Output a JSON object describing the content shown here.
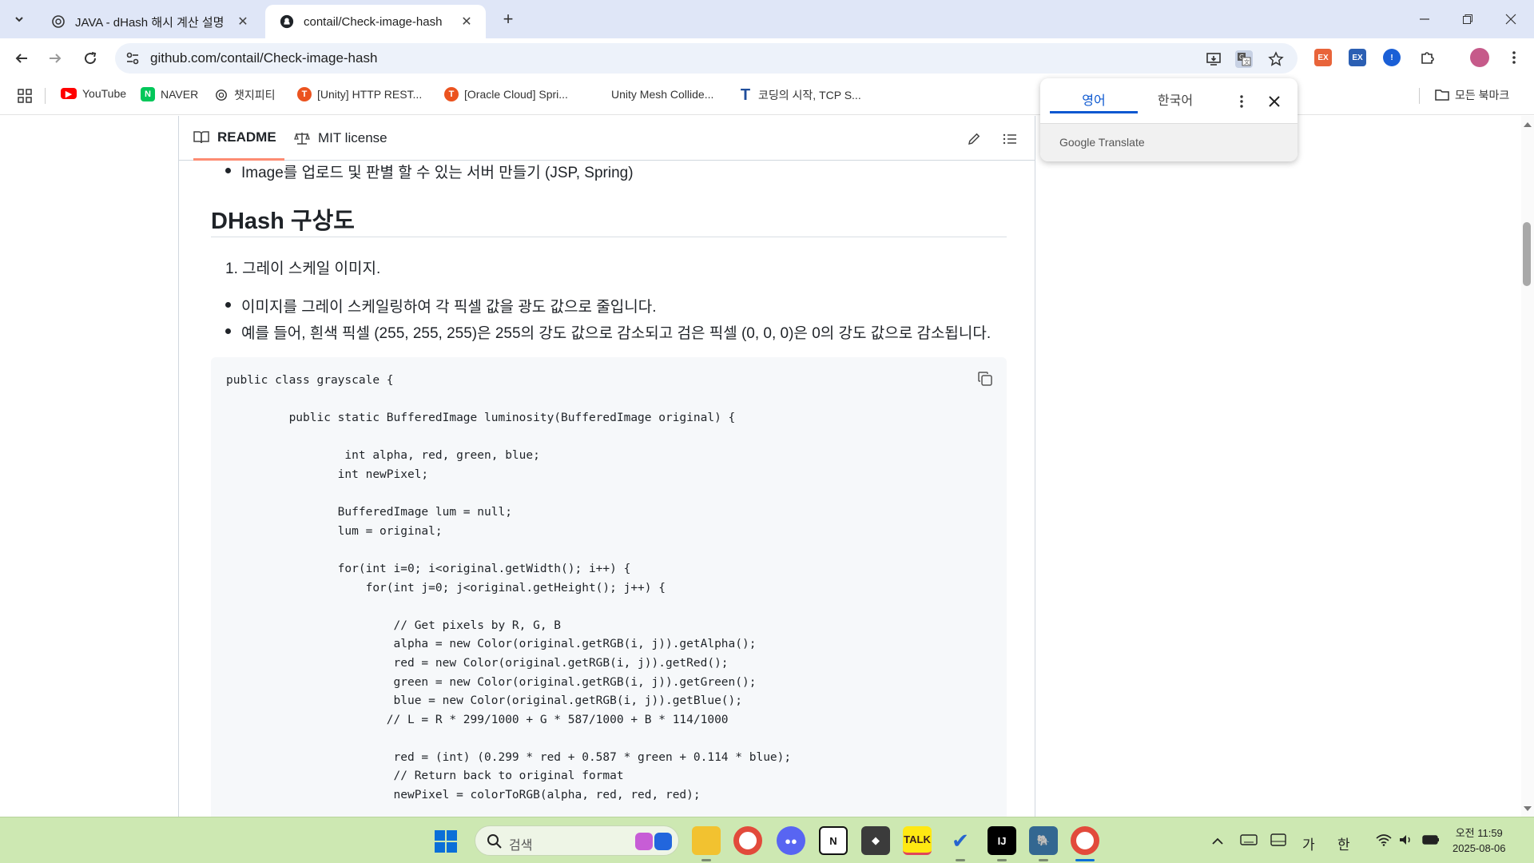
{
  "browser": {
    "tabs": [
      {
        "title": "JAVA - dHash 해시 계산 설명",
        "icon": "chatgpt-icon"
      },
      {
        "title": "contail/Check-image-hash",
        "icon": "github-icon"
      }
    ],
    "url": "github.com/contail/Check-image-hash"
  },
  "bookmarks": [
    {
      "label": "YouTube",
      "icon": "youtube-icon",
      "color": "#ff0000"
    },
    {
      "label": "NAVER",
      "icon": "naver-icon",
      "color": "#03c75a"
    },
    {
      "label": "챗지피티",
      "icon": "chatgpt-icon",
      "color": "#333333"
    },
    {
      "label": "[Unity] HTTP REST...",
      "icon": "tistory-icon",
      "color": "#eb531f"
    },
    {
      "label": "[Oracle Cloud] Spri...",
      "icon": "tistory-icon",
      "color": "#eb531f"
    },
    {
      "label": "Unity Mesh Collide...",
      "icon": "unity-icon",
      "color": "#222222"
    },
    {
      "label": "코딩의 시작, TCP S...",
      "icon": "tcp-school-icon",
      "color": "#1f4e9c"
    }
  ],
  "bookmarks_all": "모든 북마크",
  "translate": {
    "lang_from": "영어",
    "lang_to": "한국어",
    "brand": "Google Translate"
  },
  "readme": {
    "tab_readme": "README",
    "tab_license": "MIT license",
    "top_bullet": "Image를 업로드 및 판별 할 수 있는 서버 만들기 (JSP, Spring)",
    "heading": "DHash 구상도",
    "ordered_item": "1. 그레이 스케일 이미지.",
    "bullets": [
      "이미지를 그레이 스케일링하여 각 픽셀 값을 광도 값으로 줄입니다.",
      "예를 들어, 흰색 픽셀 (255, 255, 255)은 255의 강도 값으로 감소되고 검은 픽셀 (0, 0, 0)은 0의 강도 값으로 감소됩니다."
    ],
    "code": "public class grayscale {\n\n         public static BufferedImage luminosity(BufferedImage original) {\n\n                 int alpha, red, green, blue;\n                int newPixel;\n\n                BufferedImage lum = null;\n                lum = original;\n\n                for(int i=0; i<original.getWidth(); i++) {\n                    for(int j=0; j<original.getHeight(); j++) {\n\n                        // Get pixels by R, G, B\n                        alpha = new Color(original.getRGB(i, j)).getAlpha();\n                        red = new Color(original.getRGB(i, j)).getRed();\n                        green = new Color(original.getRGB(i, j)).getGreen();\n                        blue = new Color(original.getRGB(i, j)).getBlue();\n                       // L = R * 299/1000 + G * 587/1000 + B * 114/1000\n\n                        red = (int) (0.299 * red + 0.587 * green + 0.114 * blue);\n                        // Return back to original format\n                        newPixel = colorToRGB(alpha, red, red, red);"
  },
  "taskbar": {
    "search_placeholder": "검색",
    "ime_lang": "가",
    "ime_mode": "한",
    "time": "오전 11:59",
    "date": "2025-08-06"
  }
}
